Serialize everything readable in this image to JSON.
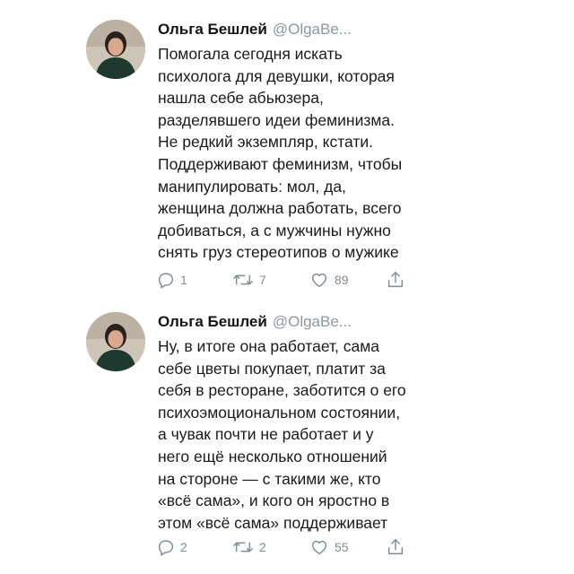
{
  "tweets": [
    {
      "author": "Ольга Бешлей",
      "handle": "@OlgaBe...",
      "lines": [
        "Помогала сегодня искать",
        "психолога для девушки, которая",
        "нашла себе абьюзера,",
        "разделявшего идеи феминизма.",
        "Не редкий экземпляр, кстати.",
        "Поддерживают феминизм, чтобы",
        "манипулировать: мол, да,",
        "женщина должна работать, всего",
        "добиваться, а с мужчины нужно",
        "снять груз стереотипов о мужике"
      ],
      "replies": "1",
      "retweets": "7",
      "likes": "89"
    },
    {
      "author": "Ольга Бешлей",
      "handle": "@OlgaBe...",
      "lines": [
        "Ну, в итоге она работает, сама",
        "себе цветы покупает, платит за",
        "себя в ресторане, заботится о его",
        "психоэмоциональном состоянии,",
        "а чувак почти не работает и у",
        "него ещё несколько отношений",
        "на стороне — с такими же, кто",
        "«всё сама», и кого он яростно в",
        "этом «всё сама» поддерживает"
      ],
      "replies": "2",
      "retweets": "2",
      "likes": "55"
    }
  ],
  "icons": {
    "reply": "reply-icon",
    "retweet": "retweet-icon",
    "like": "like-icon",
    "share": "share-icon"
  },
  "colors": {
    "icon": "#7f8d99",
    "handle": "#8b98a4",
    "text": "#1a1a1a"
  }
}
